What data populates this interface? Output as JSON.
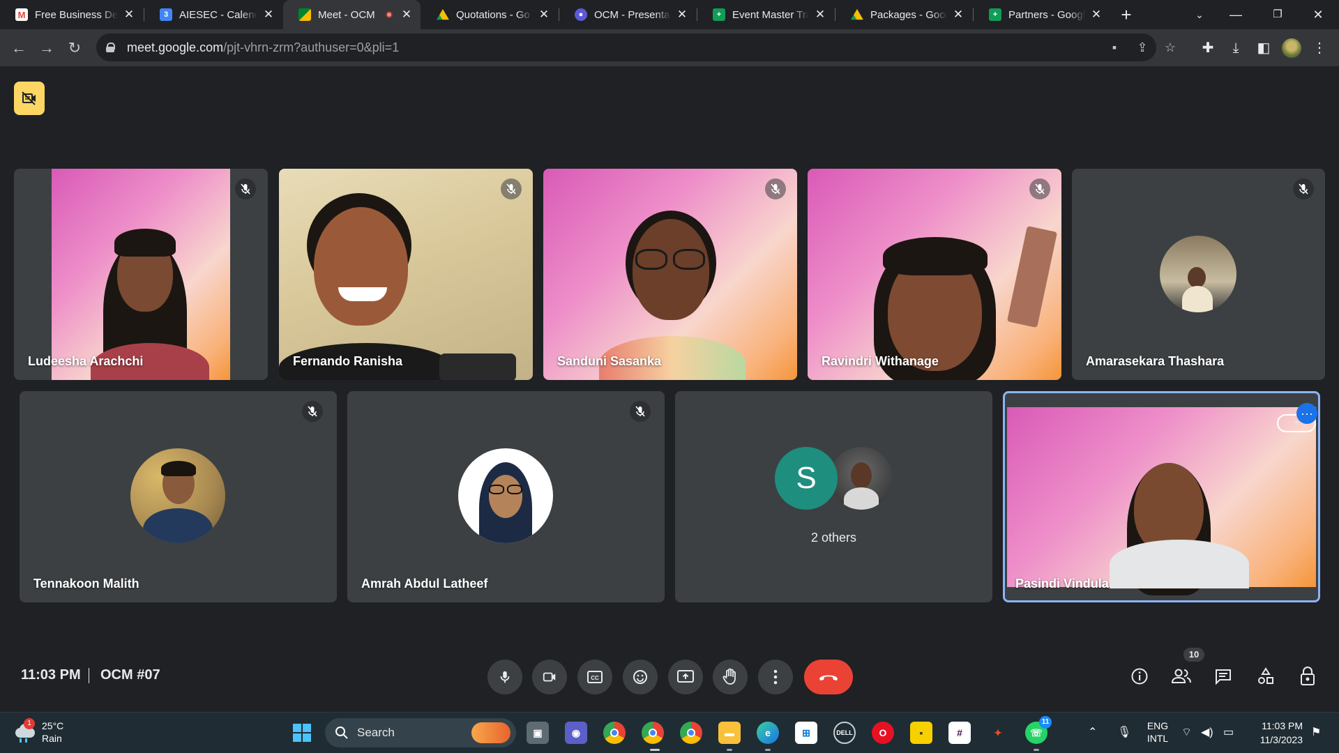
{
  "browser": {
    "tabs": [
      {
        "title": "Free Business De",
        "favicon": "gmail-icon",
        "active": false
      },
      {
        "title": "AIESEC - Calenda",
        "favicon": "calendar-icon",
        "active": false
      },
      {
        "title": "Meet - OCM",
        "favicon": "meet-icon",
        "active": true,
        "recording": true
      },
      {
        "title": "Quotations - Go",
        "favicon": "drive-icon",
        "active": false
      },
      {
        "title": "OCM - Presentat",
        "favicon": "canva-icon",
        "active": false
      },
      {
        "title": "Event Master Tra",
        "favicon": "sheets-icon",
        "active": false
      },
      {
        "title": "Packages - Goog",
        "favicon": "drive-icon",
        "active": false
      },
      {
        "title": "Partners - Googl",
        "favicon": "sheets-icon",
        "active": false
      }
    ],
    "new_tab_label": "+",
    "url_host": "meet.google.com",
    "url_path": "/pjt-vhrn-zrm?authuser=0&pli=1"
  },
  "meet": {
    "participants_row1": [
      {
        "name": "Ludeesha Arachchi",
        "muted": true
      },
      {
        "name": "Fernando Ranisha",
        "muted": true
      },
      {
        "name": "Sanduni Sasanka",
        "muted": true
      },
      {
        "name": "Ravindri Withanage",
        "muted": true
      },
      {
        "name": "Amarasekara Thashara",
        "muted": true
      }
    ],
    "participants_row2": [
      {
        "name": "Tennakoon Malith",
        "muted": true
      },
      {
        "name": "Amrah Abdul Latheef",
        "muted": true
      },
      {
        "name": "2 others",
        "avatar_letter": "S"
      },
      {
        "name": "Pasindi Vindula",
        "self": true
      }
    ],
    "clock": "11:03 PM",
    "meeting_code": "OCM #07",
    "participant_count": "10",
    "colors": {
      "leave": "#ea4335",
      "accent": "#8ab4f8",
      "badge": "#fdd663",
      "avatar_s": "#1e8e7e"
    }
  },
  "taskbar": {
    "weather_temp": "25°C",
    "weather_desc": "Rain",
    "weather_badge": "1",
    "search_label": "Search",
    "whatsapp_badge": "11",
    "language": "ENG",
    "layout": "INTL",
    "time": "11:03 PM",
    "date": "11/3/2023"
  }
}
